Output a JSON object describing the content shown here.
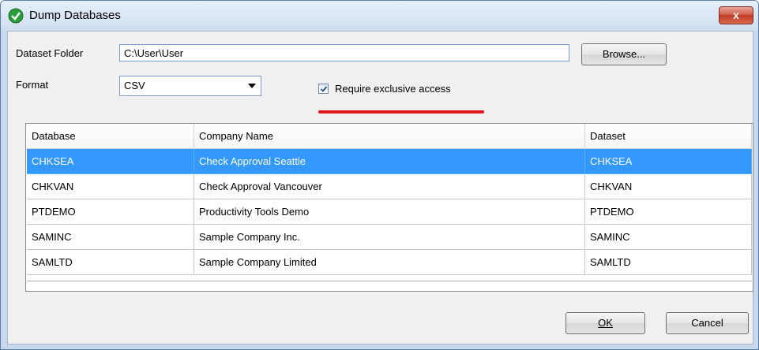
{
  "window": {
    "title": "Dump Databases",
    "close_label": "x"
  },
  "form": {
    "dataset_folder_label": "Dataset Folder",
    "dataset_folder_value": "C:\\User\\User",
    "browse_label": "Browse...",
    "format_label": "Format",
    "format_value": "CSV",
    "exclusive_label": "Require exclusive access",
    "exclusive_checked": true
  },
  "table": {
    "columns": [
      "Database",
      "Company Name",
      "Dataset"
    ],
    "rows": [
      {
        "database": "CHKSEA",
        "company": "Check Approval Seattle",
        "dataset": "CHKSEA",
        "selected": true
      },
      {
        "database": "CHKVAN",
        "company": "Check Approval Vancouver",
        "dataset": "CHKVAN",
        "selected": false
      },
      {
        "database": "PTDEMO",
        "company": "Productivity Tools Demo",
        "dataset": "PTDEMO",
        "selected": false
      },
      {
        "database": "SAMINC",
        "company": "Sample Company Inc.",
        "dataset": "SAMINC",
        "selected": false
      },
      {
        "database": "SAMLTD",
        "company": "Sample Company Limited",
        "dataset": "SAMLTD",
        "selected": false
      }
    ]
  },
  "buttons": {
    "ok": "OK",
    "cancel": "Cancel"
  },
  "colors": {
    "selection": "#3399ff",
    "annotation_underline": "#e0151d"
  }
}
